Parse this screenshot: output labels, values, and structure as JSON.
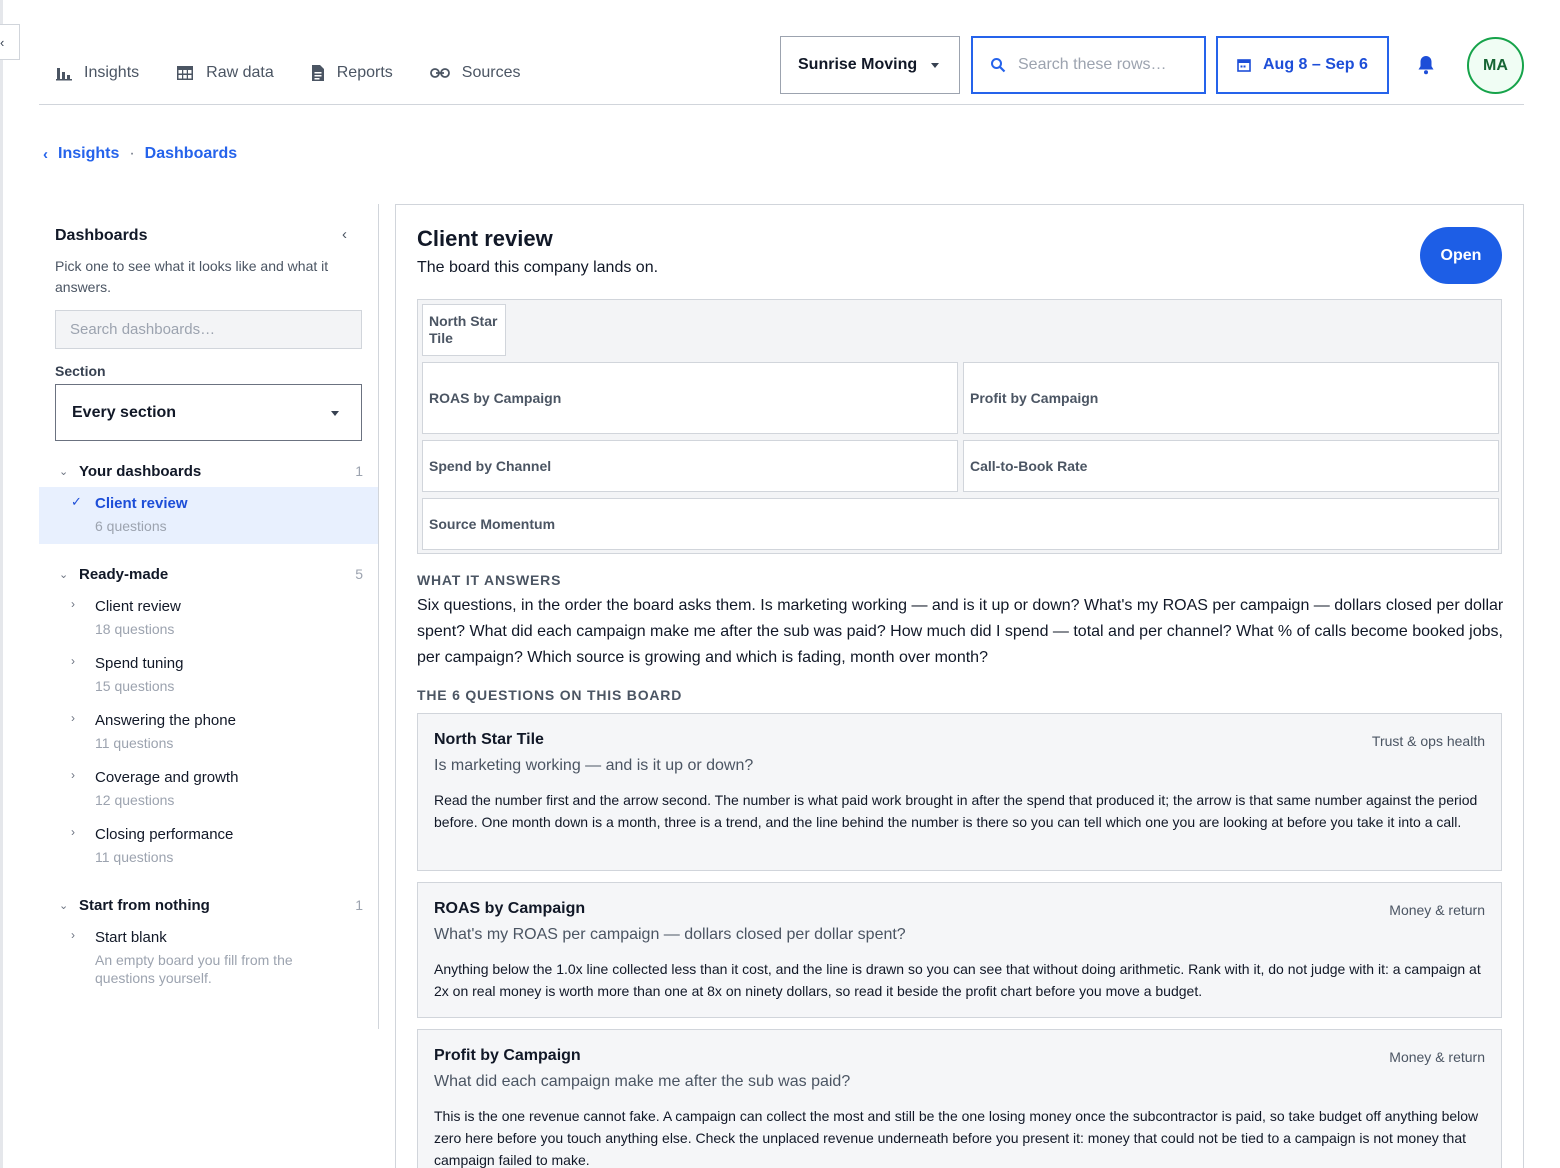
{
  "nav": {
    "items": [
      {
        "label": "Insights",
        "icon": "bar-chart-icon"
      },
      {
        "label": "Raw data",
        "icon": "table-icon"
      },
      {
        "label": "Reports",
        "icon": "document-icon"
      },
      {
        "label": "Sources",
        "icon": "link-icon"
      }
    ]
  },
  "header": {
    "company": "Sunrise Moving",
    "row_search_placeholder": "Search these rows…",
    "date_range": "Aug 8 – Sep 6",
    "avatar_initials": "MA"
  },
  "breadcrumb": {
    "items": [
      "Insights",
      "Dashboards"
    ]
  },
  "sidebar": {
    "title": "Dashboards",
    "description": "Pick one to see what it looks like and what it answers.",
    "search_placeholder": "Search dashboards…",
    "section_label": "Section",
    "section_value": "Every section",
    "groups": [
      {
        "title": "Your dashboards",
        "count": "1",
        "items": [
          {
            "name": "Client review",
            "sub": "6 questions",
            "active": true
          }
        ]
      },
      {
        "title": "Ready-made",
        "count": "5",
        "items": [
          {
            "name": "Client review",
            "sub": "18 questions"
          },
          {
            "name": "Spend tuning",
            "sub": "15 questions"
          },
          {
            "name": "Answering the phone",
            "sub": "11 questions"
          },
          {
            "name": "Coverage and growth",
            "sub": "12 questions"
          },
          {
            "name": "Closing performance",
            "sub": "11 questions"
          }
        ]
      },
      {
        "title": "Start from nothing",
        "count": "1",
        "items": [
          {
            "name": "Start blank",
            "sub": "An empty board you fill from the questions yourself."
          }
        ]
      }
    ]
  },
  "main": {
    "title": "Client review",
    "subtitle": "The board this company lands on.",
    "open_label": "Open",
    "tiles": [
      "North Star Tile",
      "ROAS by Campaign",
      "Profit by Campaign",
      "Spend by Channel",
      "Call-to-Book Rate",
      "Source Momentum"
    ],
    "answers_heading": "WHAT IT ANSWERS",
    "answers_text": "Six questions, in the order the board asks them. Is marketing working — and is it up or down? What's my ROAS per campaign — dollars closed per dollar spent? What did each campaign make me after the sub was paid? How much did I spend — total and per channel? What % of calls become booked jobs, per campaign? Which source is growing and which is fading, month over month?",
    "questions_heading": "THE 6 QUESTIONS ON THIS BOARD",
    "questions": [
      {
        "name": "North Star Tile",
        "category": "Trust & ops health",
        "question": "Is marketing working — and is it up or down?",
        "body": "Read the number first and the arrow second. The number is what paid work brought in after the spend that produced it; the arrow is that same number against the period before. One month down is a month, three is a trend, and the line behind the number is there so you can tell which one you are looking at before you take it into a call."
      },
      {
        "name": "ROAS by Campaign",
        "category": "Money & return",
        "question": "What's my ROAS per campaign — dollars closed per dollar spent?",
        "body": "Anything below the 1.0x line collected less than it cost, and the line is drawn so you can see that without doing arithmetic. Rank with it, do not judge with it: a campaign at 2x on real money is worth more than one at 8x on ninety dollars, so read it beside the profit chart before you move a budget."
      },
      {
        "name": "Profit by Campaign",
        "category": "Money & return",
        "question": "What did each campaign make me after the sub was paid?",
        "body": "This is the one revenue cannot fake. A campaign can collect the most and still be the one losing money once the subcontractor is paid, so take budget off anything below zero here before you touch anything else. Check the unplaced revenue underneath before you present it: money that could not be tied to a campaign is not money that campaign failed to make."
      }
    ]
  },
  "colors": {
    "accent": "#2563eb",
    "open_button": "#1d5ee6",
    "avatar_ring": "#16a34a",
    "active_item_bg": "#e8f0fe"
  }
}
